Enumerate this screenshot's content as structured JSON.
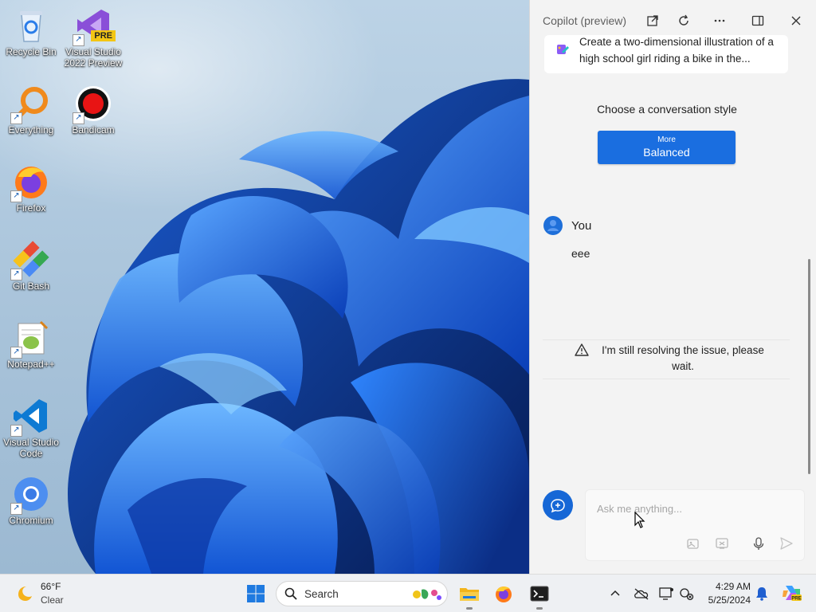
{
  "desktop": {
    "icons": [
      {
        "label": "Recycle Bin",
        "icon": "recycle-bin-icon"
      },
      {
        "label": "Visual Studio\n2022 Preview",
        "icon": "visual-studio-preview-icon",
        "badge": "PRE"
      },
      {
        "label": "Everything",
        "icon": "everything-search-icon"
      },
      {
        "label": "Bandicam",
        "icon": "bandicam-icon"
      },
      {
        "label": "Firefox",
        "icon": "firefox-icon"
      },
      {
        "label": "Git Bash",
        "icon": "git-bash-icon"
      },
      {
        "label": "Notepad++",
        "icon": "notepad-plus-plus-icon"
      },
      {
        "label": "Visual Studio\nCode",
        "icon": "vscode-icon"
      },
      {
        "label": "Chromium",
        "icon": "chromium-icon"
      }
    ]
  },
  "copilot": {
    "title": "Copilot (preview)",
    "header_buttons": [
      "open-external-icon",
      "refresh-icon",
      "more-icon",
      "split-view-icon",
      "close-icon"
    ],
    "prompt_suggestion": "Create a two-dimensional illustration of a high school girl riding a bike in the...",
    "style_label": "Choose a conversation style",
    "style_button": {
      "small": "More",
      "big": "Balanced"
    },
    "user_name": "You",
    "user_message": "eee",
    "warning": "I'm still resolving the issue, please wait.",
    "input_placeholder": "Ask me anything...",
    "accent": "#1a6ee0"
  },
  "taskbar": {
    "weather_temp": "66°F",
    "weather_cond": "Clear",
    "search_label": "Search",
    "apps": [
      "file-explorer-icon",
      "firefox-icon",
      "terminal-icon"
    ],
    "tray": [
      "chevron-up-icon",
      "onedrive-offline-icon",
      "display-icon",
      "network-icon"
    ],
    "clock_time": "4:29 AM",
    "clock_date": "5/25/2024"
  }
}
